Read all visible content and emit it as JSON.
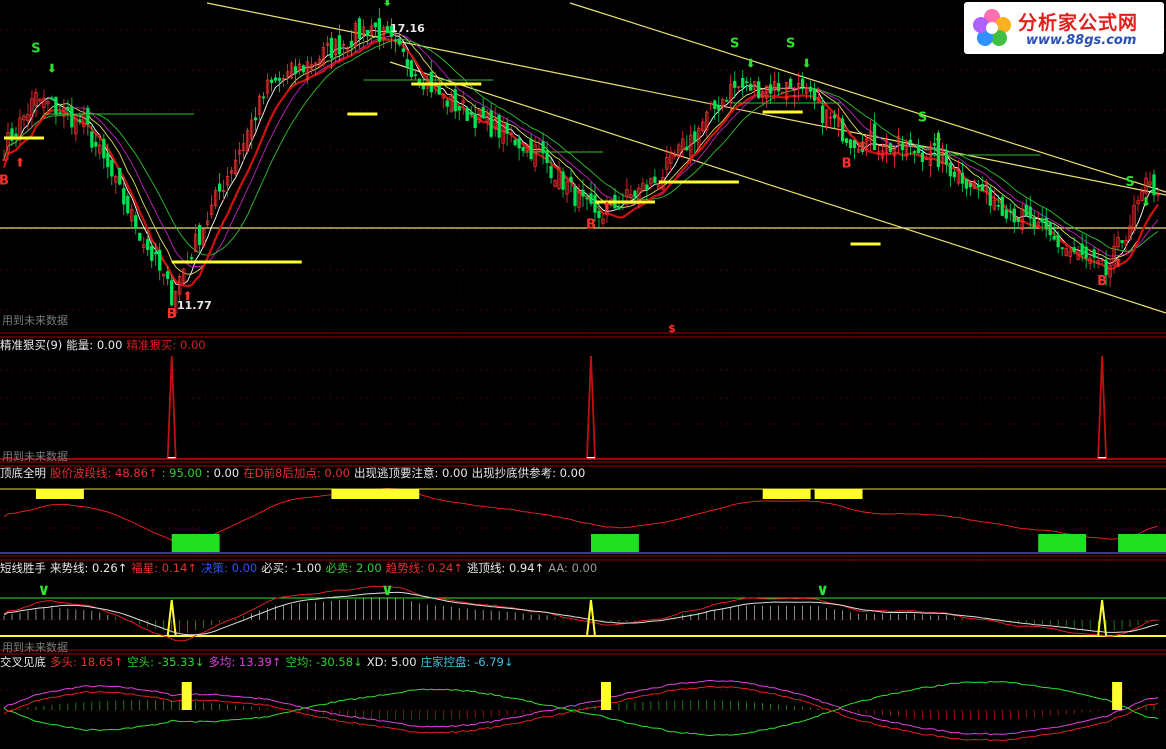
{
  "logo": {
    "name": "分析家公式网",
    "url_text": "www.88gs.com"
  },
  "future_warning": "用到未来数据",
  "main_panel": {
    "high_label": "17.16",
    "low_label": "11.77",
    "sell_letter": "S",
    "buy_letter": "B",
    "marker": "$"
  },
  "panels": [
    {
      "id": "p1",
      "items": [
        {
          "text": "精准狠买(9)",
          "color": "#e8e8e8"
        },
        {
          "text": "能量: 0.00",
          "color": "#e8e8e8"
        },
        {
          "text": "精准狠买: 0.00",
          "color": "#d02020"
        }
      ]
    },
    {
      "id": "p2",
      "items": [
        {
          "text": "顶底全明",
          "color": "#e8e8e8"
        },
        {
          "text": "股价波段线: 48.86↑",
          "color": "#e83030"
        },
        {
          "text": ": 95.00",
          "color": "#30d030"
        },
        {
          "text": ": 0.00",
          "color": "#e8e8e8"
        },
        {
          "text": "在D前8后加点: 0.00",
          "color": "#e83030"
        },
        {
          "text": "出现逃顶要注意: 0.00",
          "color": "#e8e8e8"
        },
        {
          "text": "出现抄底供参考: 0.00",
          "color": "#e8e8e8"
        }
      ]
    },
    {
      "id": "p3",
      "items": [
        {
          "text": "短线胜手",
          "color": "#e8e8e8"
        },
        {
          "text": "来势线: 0.26↑",
          "color": "#e8e8e8"
        },
        {
          "text": "福星: 0.14↑",
          "color": "#e83030"
        },
        {
          "text": "决策: 0.00",
          "color": "#3050ff"
        },
        {
          "text": "必买: -1.00",
          "color": "#e8e8e8"
        },
        {
          "text": "必卖: 2.00",
          "color": "#30d030"
        },
        {
          "text": "趋势线: 0.24↑",
          "color": "#e83030"
        },
        {
          "text": "逃顶线: 0.94↑",
          "color": "#e8e8e8"
        },
        {
          "text": "AA: 0.00",
          "color": "#9a9a9a"
        }
      ]
    },
    {
      "id": "p4",
      "items": [
        {
          "text": "交叉见底",
          "color": "#e8e8e8"
        },
        {
          "text": "多头: 18.65↑",
          "color": "#e83030"
        },
        {
          "text": "空头: -35.33↓",
          "color": "#30d030"
        },
        {
          "text": "多均: 13.39↑",
          "color": "#e040e0"
        },
        {
          "text": "空均: -30.58↓",
          "color": "#30d030"
        },
        {
          "text": "XD: 5.00",
          "color": "#e8e8e8"
        },
        {
          "text": "庄家控盘: -6.79↓",
          "color": "#40c0e0"
        }
      ]
    }
  ],
  "chart_data": {
    "type": "candlestick",
    "price_high": 17.16,
    "price_low": 11.77,
    "key_points": [
      {
        "i": 0,
        "p": 14.7
      },
      {
        "i": 8,
        "p": 15.7
      },
      {
        "i": 20,
        "p": 15.2
      },
      {
        "i": 42,
        "p": 11.77
      },
      {
        "i": 66,
        "p": 15.9
      },
      {
        "i": 92,
        "p": 17.16
      },
      {
        "i": 110,
        "p": 15.7
      },
      {
        "i": 134,
        "p": 14.6
      },
      {
        "i": 148,
        "p": 13.3
      },
      {
        "i": 164,
        "p": 14.1
      },
      {
        "i": 182,
        "p": 15.9
      },
      {
        "i": 198,
        "p": 15.95
      },
      {
        "i": 212,
        "p": 14.9
      },
      {
        "i": 232,
        "p": 14.6
      },
      {
        "i": 262,
        "p": 12.9
      },
      {
        "i": 276,
        "p": 12.2
      },
      {
        "i": 286,
        "p": 13.9
      }
    ],
    "sell_signals": [
      8,
      92,
      183,
      197,
      230,
      282
    ],
    "buy_signals": [
      0,
      42,
      147,
      211,
      275
    ],
    "spike_signals": [
      42,
      147,
      275
    ]
  },
  "colors": {
    "up": "#ff3030",
    "down": "#00e050",
    "grid": "#8b0000",
    "trend": "#e8e070",
    "signal": "#ffff30"
  }
}
